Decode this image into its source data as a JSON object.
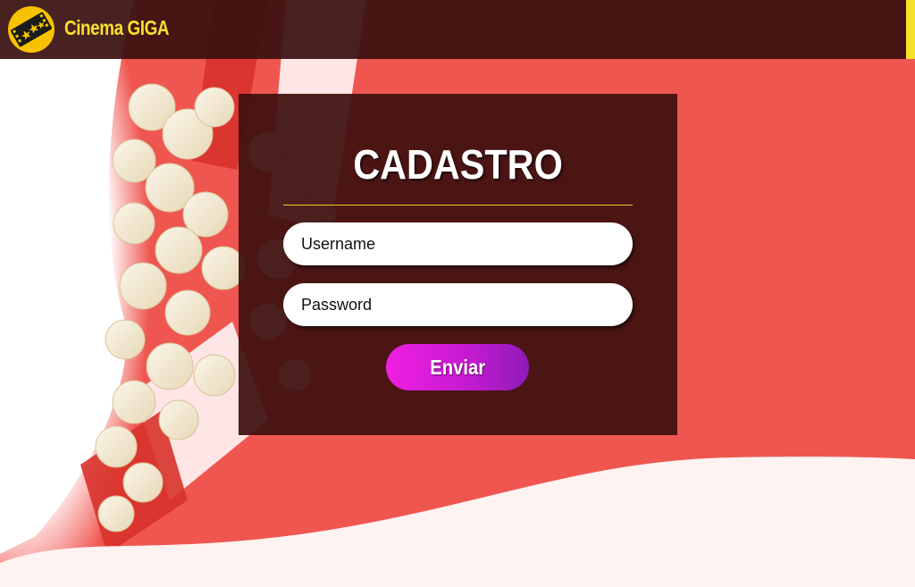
{
  "header": {
    "brand": "Cinema GIGA"
  },
  "form": {
    "title": "CADASTRO",
    "username_placeholder": "Username",
    "password_placeholder": "Password",
    "submit_label": "Enviar"
  },
  "icons": {
    "logo": "film-ticket-icon",
    "background": "popcorn-image"
  },
  "colors": {
    "header_bg": "#3a1010",
    "accent_yellow": "#f7e02a",
    "page_red": "#f05650",
    "wave_white": "#fff3f2",
    "card_bg": "#3e1010",
    "button_gradient_start": "#f01fe0",
    "button_gradient_end": "#8e1bb8"
  }
}
